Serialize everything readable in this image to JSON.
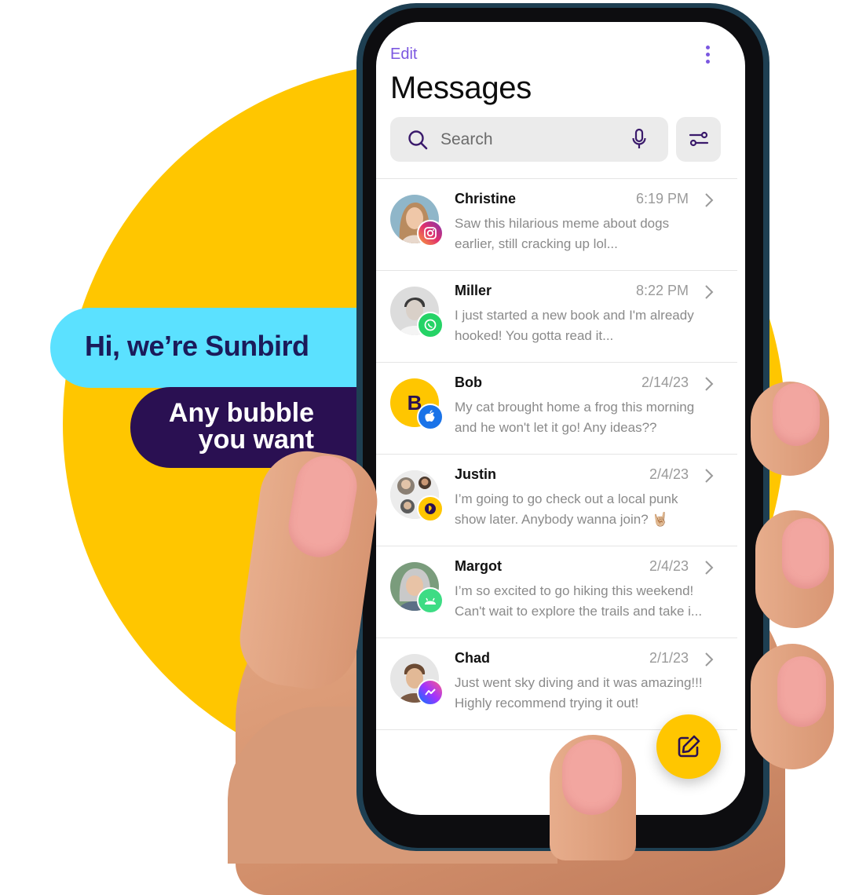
{
  "promo": {
    "bubble_1": "Hi, we’re Sunbird",
    "bubble_2_line_1": "Any bubble",
    "bubble_2_line_2": "you want",
    "colors": {
      "yellow": "#FFC600",
      "cyan": "#5BE1FF",
      "purple": "#2A1052"
    }
  },
  "header": {
    "edit_label": "Edit",
    "title": "Messages",
    "more_icon": "vertical-dots-icon"
  },
  "search": {
    "placeholder": "Search",
    "icons": [
      "search-icon",
      "mic-icon",
      "filter-sliders-icon"
    ]
  },
  "conversations": [
    {
      "name": "Christine",
      "time": "6:19 PM",
      "preview_1": "Saw this hilarious meme about dogs",
      "preview_2": "earlier, still cracking up lol...",
      "platform": "instagram"
    },
    {
      "name": "Miller",
      "time": "8:22 PM",
      "preview_1": "I just started a new book and I'm already",
      "preview_2": "hooked! You gotta read it...",
      "platform": "whatsapp"
    },
    {
      "name": "Bob",
      "initial": "B",
      "time": "2/14/23",
      "preview_1": "My cat brought home a frog this morning",
      "preview_2": "and he won't let it go! Any ideas??",
      "platform": "apple"
    },
    {
      "name": "Justin",
      "time": "2/4/23",
      "preview_1": "I’m going to go check out a local punk",
      "preview_2": "show later. Anybody wanna join? 🤘🏼",
      "platform": "sunbird"
    },
    {
      "name": "Margot",
      "time": "2/4/23",
      "preview_1": "I’m so excited to go hiking this weekend!",
      "preview_2": "Can't wait to explore the trails and take i...",
      "platform": "android"
    },
    {
      "name": "Chad",
      "time": "2/1/23",
      "preview_1": "Just went sky diving and it was amazing!!!",
      "preview_2": "Highly recommend trying it out!",
      "platform": "messenger"
    }
  ],
  "compose": {
    "icon": "compose-pencil-icon"
  }
}
